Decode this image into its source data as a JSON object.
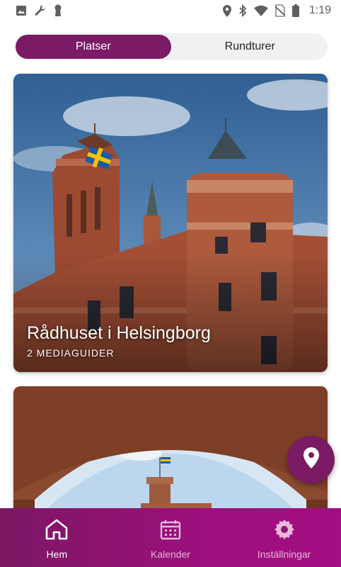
{
  "status_bar": {
    "time": "1:19",
    "left_icons": [
      "image-icon",
      "wrench-icon",
      "keyhole-icon"
    ],
    "right_icons": [
      "location-icon",
      "bluetooth-icon",
      "wifi-icon",
      "no-sim-icon",
      "battery-icon"
    ]
  },
  "tabs": [
    {
      "label": "Platser",
      "active": true
    },
    {
      "label": "Rundturer",
      "active": false
    }
  ],
  "cards": [
    {
      "title": "Rådhuset i Helsingborg",
      "subtitle": "2 MEDIAGUIDER"
    },
    {
      "title": "",
      "subtitle": ""
    }
  ],
  "fab": {
    "icon": "map-pin-icon"
  },
  "bottom_nav": [
    {
      "label": "Hem",
      "icon": "home-icon",
      "active": true
    },
    {
      "label": "Kalender",
      "icon": "calendar-icon",
      "active": false
    },
    {
      "label": "Inställningar",
      "icon": "gear-icon",
      "active": false
    }
  ],
  "colors": {
    "accent": "#7b1a65",
    "nav_gradient_start": "#7c1863",
    "nav_gradient_end": "#a30e82"
  }
}
